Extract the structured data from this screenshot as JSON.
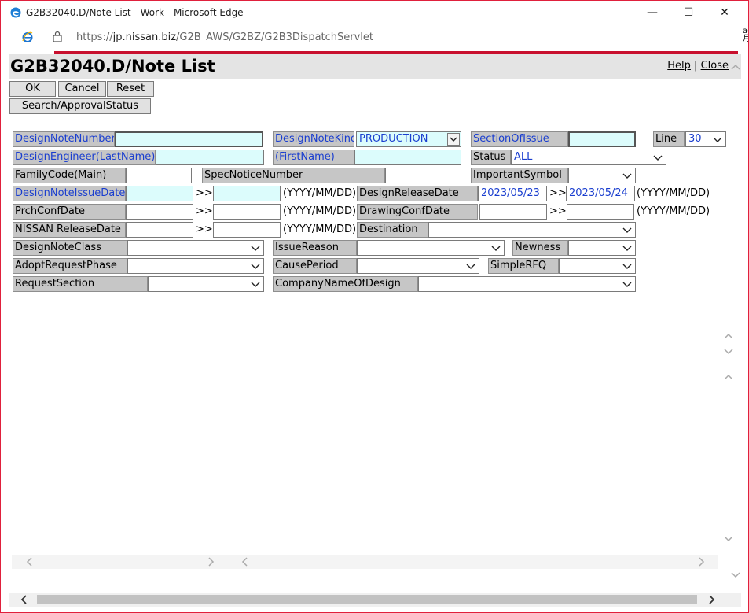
{
  "window": {
    "title": "G2B32040.D/Note List - Work - Microsoft Edge",
    "minimize": "—",
    "maximize": "☐",
    "close": "✕"
  },
  "address": {
    "prefix": "https://",
    "host": "jp.nissan.biz",
    "path": "/G2B_AWS/G2BZ/G2B3DispatchServlet"
  },
  "side_fragment": "ae\n月",
  "page": {
    "title": "G2B32040.D/Note List",
    "help_link": "Help",
    "separator": "|",
    "close_link": "Close"
  },
  "buttons": {
    "ok": "OK",
    "cancel": "Cancel",
    "reset": "Reset",
    "search_approval": "Search/ApprovalStatus"
  },
  "form": {
    "design_note_number": {
      "label": "DesignNoteNumber",
      "value": ""
    },
    "design_note_kind": {
      "label": "DesignNoteKind",
      "value": "PRODUCTION"
    },
    "section_of_issue": {
      "label": "SectionOfIssue",
      "value": ""
    },
    "line": {
      "label": "Line",
      "value": "30"
    },
    "design_engineer_last": {
      "label": "DesignEngineer(LastName)",
      "value": ""
    },
    "first_name": {
      "label": "(FirstName)",
      "value": ""
    },
    "status": {
      "label": "Status",
      "value": "ALL"
    },
    "family_code": {
      "label": "FamilyCode(Main)",
      "value": ""
    },
    "spec_notice_number": {
      "label": "SpecNoticeNumber",
      "value": ""
    },
    "important_symbol": {
      "label": "ImportantSymbol",
      "value": ""
    },
    "design_note_issue_date": {
      "label": "DesignNoteIssueDate",
      "from": "",
      "to": ""
    },
    "design_release_date": {
      "label": "DesignReleaseDate",
      "from": "2023/05/23",
      "to": "2023/05/24"
    },
    "prch_conf_date": {
      "label": "PrchConfDate",
      "from": "",
      "to": ""
    },
    "drawing_conf_date": {
      "label": "DrawingConfDate",
      "from": "",
      "to": ""
    },
    "nissan_release_date": {
      "label": "NISSAN ReleaseDate",
      "from": "",
      "to": ""
    },
    "destination": {
      "label": "Destination",
      "value": ""
    },
    "design_note_class": {
      "label": "DesignNoteClass",
      "value": ""
    },
    "issue_reason": {
      "label": "IssueReason",
      "value": ""
    },
    "newness": {
      "label": "Newness",
      "value": ""
    },
    "adopt_request_phase": {
      "label": "AdoptRequestPhase",
      "value": ""
    },
    "cause_period": {
      "label": "CausePeriod",
      "value": ""
    },
    "simple_rfq": {
      "label": "SimpleRFQ",
      "value": ""
    },
    "request_section": {
      "label": "RequestSection",
      "value": ""
    },
    "company_name_of_design": {
      "label": "CompanyNameOfDesign",
      "value": ""
    },
    "range_sep": ">>",
    "date_format": "(YYYY/MM/DD)"
  },
  "colors": {
    "accent_red": "#c8102e",
    "label_blue": "#1a3ecf",
    "required_cyan": "#dcfcfc",
    "label_gray": "#c6c6c6"
  }
}
